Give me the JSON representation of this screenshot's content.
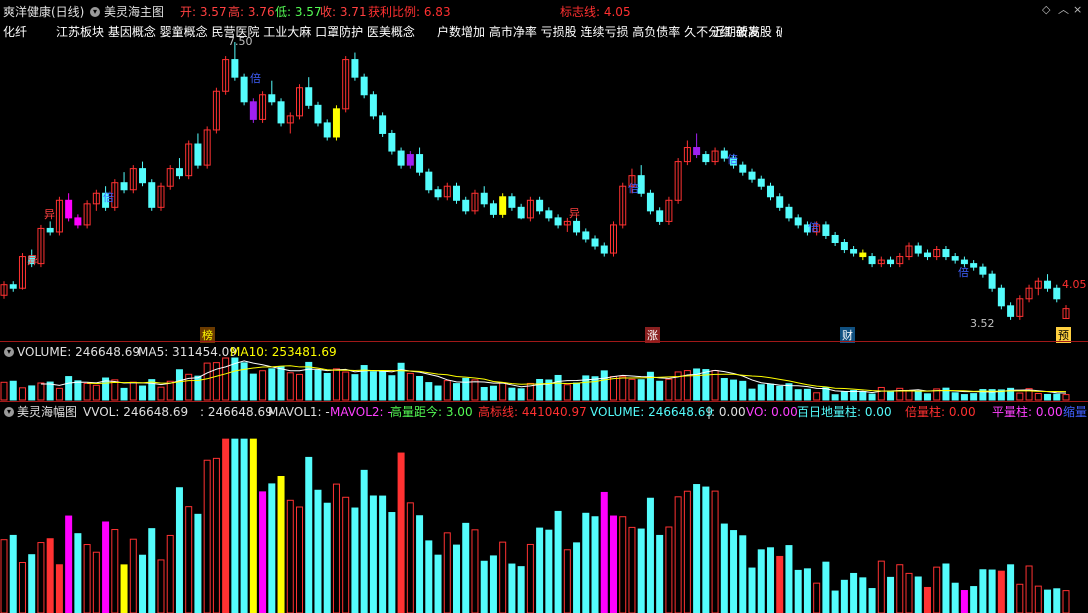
{
  "header": {
    "stock_name": "爽洋健康(日线)",
    "indicator_name": "美灵海主图",
    "open": "开: 3.57",
    "high": "高: 3.76",
    "low": "低: 3.57",
    "close": "收: 3.71",
    "profit_ratio": "获利比例: 6.83",
    "flag_line": "标志线: 4.05"
  },
  "concepts": {
    "left": "化纤",
    "group1": "江苏板块  基因概念 婴童概念 民营医院 工业大麻 口罩防护 医美概念",
    "group2": "户数增加 高市净率 亏损股 连续亏损 高负债率 久不分红 破发股 破净股",
    "overlap_text": "近期新高"
  },
  "price_panel": {
    "high_label": "7.50",
    "low_label": "3.52",
    "flag_price_label": "4.05",
    "tag_bang": "榜",
    "tag_zhang": "涨",
    "tag_cai": "财",
    "tag_yu": "预",
    "char_yi": "异",
    "char_bei": "倍",
    "char_zhu": "主",
    "char_ping": "平",
    "char_di": "地"
  },
  "volume_panel": {
    "volume": "VOLUME: 246648.69",
    "ma5": "MA5: 311454.09",
    "ma10": "MA10: 253481.69"
  },
  "amplitude_panel": {
    "name": "美灵海幅图",
    "vvol": "VVOL: 246648.69",
    "val": ": 246648.69",
    "mavol1": "MAVOL1: -",
    "mavol2": "MAVOL2: -",
    "gaoliang": "高量距今: 3.00",
    "gaobiao": "高标线: 441040.97",
    "volume": "VOLUME: 246648.69",
    "bar": "|: 0.00",
    "vo": "VO: 0.00",
    "bairi": "百日地量柱: 0.00",
    "beiliang": "倍量柱: 0.00",
    "pingliang": "平量柱: 0.00",
    "suoliang": "缩量"
  },
  "colors": {
    "up": "#ff3232",
    "down": "#54fcfc",
    "yellow": "#ffff00",
    "magenta": "#ff00ff",
    "purple": "#a020f0",
    "ma5": "#ffffff",
    "ma10": "#ffff00",
    "separator": "#a01818"
  },
  "chart_data": {
    "type": "candlestick",
    "price_range": [
      3.52,
      7.5
    ],
    "ohlc": [
      [
        3.9,
        4.1,
        3.85,
        4.05
      ],
      [
        4.05,
        4.1,
        3.95,
        4.0
      ],
      [
        4.0,
        4.5,
        3.98,
        4.45
      ],
      [
        4.45,
        4.55,
        4.3,
        4.35
      ],
      [
        4.35,
        4.9,
        4.3,
        4.85
      ],
      [
        4.85,
        4.95,
        4.75,
        4.8
      ],
      [
        4.8,
        5.3,
        4.75,
        5.25
      ],
      [
        5.25,
        5.35,
        4.95,
        5.0
      ],
      [
        5.0,
        5.05,
        4.85,
        4.9
      ],
      [
        4.9,
        5.25,
        4.85,
        5.2
      ],
      [
        5.2,
        5.4,
        5.1,
        5.35
      ],
      [
        5.35,
        5.45,
        5.1,
        5.15
      ],
      [
        5.15,
        5.55,
        5.1,
        5.5
      ],
      [
        5.5,
        5.65,
        5.35,
        5.4
      ],
      [
        5.4,
        5.75,
        5.35,
        5.7
      ],
      [
        5.7,
        5.8,
        5.45,
        5.5
      ],
      [
        5.5,
        5.55,
        5.1,
        5.15
      ],
      [
        5.15,
        5.5,
        5.1,
        5.45
      ],
      [
        5.45,
        5.75,
        5.4,
        5.7
      ],
      [
        5.7,
        5.85,
        5.55,
        5.6
      ],
      [
        5.6,
        6.1,
        5.55,
        6.05
      ],
      [
        6.05,
        6.2,
        5.7,
        5.75
      ],
      [
        5.75,
        6.3,
        5.7,
        6.25
      ],
      [
        6.25,
        6.85,
        6.2,
        6.8
      ],
      [
        6.8,
        7.3,
        6.75,
        7.25
      ],
      [
        7.25,
        7.5,
        6.95,
        7.0
      ],
      [
        7.0,
        7.05,
        6.6,
        6.65
      ],
      [
        6.65,
        6.7,
        6.35,
        6.4
      ],
      [
        6.4,
        6.8,
        6.35,
        6.75
      ],
      [
        6.75,
        6.95,
        6.6,
        6.65
      ],
      [
        6.65,
        6.7,
        6.3,
        6.35
      ],
      [
        6.35,
        6.5,
        6.2,
        6.45
      ],
      [
        6.45,
        6.9,
        6.4,
        6.85
      ],
      [
        6.85,
        7.0,
        6.55,
        6.6
      ],
      [
        6.6,
        6.65,
        6.3,
        6.35
      ],
      [
        6.35,
        6.4,
        6.1,
        6.15
      ],
      [
        6.15,
        6.6,
        6.1,
        6.55
      ],
      [
        6.55,
        7.3,
        6.5,
        7.25
      ],
      [
        7.25,
        7.35,
        6.95,
        7.0
      ],
      [
        7.0,
        7.05,
        6.7,
        6.75
      ],
      [
        6.75,
        6.8,
        6.4,
        6.45
      ],
      [
        6.45,
        6.5,
        6.15,
        6.2
      ],
      [
        6.2,
        6.25,
        5.9,
        5.95
      ],
      [
        5.95,
        6.0,
        5.7,
        5.75
      ],
      [
        5.75,
        5.95,
        5.7,
        5.9
      ],
      [
        5.9,
        6.0,
        5.6,
        5.65
      ],
      [
        5.65,
        5.7,
        5.35,
        5.4
      ],
      [
        5.4,
        5.45,
        5.25,
        5.3
      ],
      [
        5.3,
        5.5,
        5.25,
        5.45
      ],
      [
        5.45,
        5.5,
        5.2,
        5.25
      ],
      [
        5.25,
        5.3,
        5.05,
        5.1
      ],
      [
        5.1,
        5.4,
        5.05,
        5.35
      ],
      [
        5.35,
        5.45,
        5.15,
        5.2
      ],
      [
        5.2,
        5.25,
        5.0,
        5.05
      ],
      [
        5.05,
        5.35,
        5.0,
        5.3
      ],
      [
        5.3,
        5.35,
        5.1,
        5.15
      ],
      [
        5.15,
        5.2,
        4.98,
        5.0
      ],
      [
        5.0,
        5.3,
        4.95,
        5.25
      ],
      [
        5.25,
        5.3,
        5.05,
        5.1
      ],
      [
        5.1,
        5.15,
        4.95,
        5.0
      ],
      [
        5.0,
        5.05,
        4.85,
        4.9
      ],
      [
        4.9,
        5.0,
        4.8,
        4.95
      ],
      [
        4.95,
        5.0,
        4.75,
        4.8
      ],
      [
        4.8,
        4.85,
        4.65,
        4.7
      ],
      [
        4.7,
        4.75,
        4.55,
        4.6
      ],
      [
        4.6,
        4.65,
        4.45,
        4.5
      ],
      [
        4.5,
        4.95,
        4.45,
        4.9
      ],
      [
        4.9,
        5.5,
        4.85,
        5.45
      ],
      [
        5.45,
        5.7,
        5.35,
        5.6
      ],
      [
        5.6,
        5.75,
        5.3,
        5.35
      ],
      [
        5.35,
        5.4,
        5.05,
        5.1
      ],
      [
        5.1,
        5.15,
        4.9,
        4.95
      ],
      [
        4.95,
        5.3,
        4.9,
        5.25
      ],
      [
        5.25,
        5.85,
        5.2,
        5.8
      ],
      [
        5.8,
        6.1,
        5.75,
        6.0
      ],
      [
        6.0,
        6.2,
        5.85,
        5.9
      ],
      [
        5.9,
        5.95,
        5.75,
        5.8
      ],
      [
        5.8,
        6.0,
        5.75,
        5.95
      ],
      [
        5.95,
        6.0,
        5.8,
        5.85
      ],
      [
        5.85,
        5.9,
        5.7,
        5.75
      ],
      [
        5.75,
        5.8,
        5.6,
        5.65
      ],
      [
        5.65,
        5.7,
        5.5,
        5.55
      ],
      [
        5.55,
        5.6,
        5.4,
        5.45
      ],
      [
        5.45,
        5.5,
        5.25,
        5.3
      ],
      [
        5.3,
        5.35,
        5.1,
        5.15
      ],
      [
        5.15,
        5.2,
        4.95,
        5.0
      ],
      [
        5.0,
        5.05,
        4.85,
        4.9
      ],
      [
        4.9,
        4.95,
        4.75,
        4.8
      ],
      [
        4.8,
        4.95,
        4.75,
        4.9
      ],
      [
        4.9,
        4.95,
        4.7,
        4.75
      ],
      [
        4.75,
        4.8,
        4.6,
        4.65
      ],
      [
        4.65,
        4.7,
        4.5,
        4.55
      ],
      [
        4.55,
        4.6,
        4.45,
        4.5
      ],
      [
        4.5,
        4.55,
        4.4,
        4.45
      ],
      [
        4.45,
        4.5,
        4.3,
        4.35
      ],
      [
        4.35,
        4.45,
        4.3,
        4.4
      ],
      [
        4.4,
        4.45,
        4.3,
        4.35
      ],
      [
        4.35,
        4.5,
        4.3,
        4.45
      ],
      [
        4.45,
        4.65,
        4.4,
        4.6
      ],
      [
        4.6,
        4.65,
        4.45,
        4.5
      ],
      [
        4.5,
        4.55,
        4.4,
        4.45
      ],
      [
        4.45,
        4.6,
        4.4,
        4.55
      ],
      [
        4.55,
        4.6,
        4.4,
        4.45
      ],
      [
        4.45,
        4.5,
        4.35,
        4.4
      ],
      [
        4.4,
        4.45,
        4.3,
        4.35
      ],
      [
        4.35,
        4.4,
        4.25,
        4.3
      ],
      [
        4.3,
        4.35,
        4.15,
        4.2
      ],
      [
        4.2,
        4.25,
        3.95,
        4.0
      ],
      [
        4.0,
        4.05,
        3.7,
        3.75
      ],
      [
        3.75,
        3.8,
        3.55,
        3.6
      ],
      [
        3.6,
        3.9,
        3.55,
        3.85
      ],
      [
        3.85,
        4.05,
        3.8,
        4.0
      ],
      [
        4.0,
        4.15,
        3.9,
        4.1
      ],
      [
        4.1,
        4.2,
        3.95,
        4.0
      ],
      [
        4.0,
        4.05,
        3.8,
        3.85
      ],
      [
        3.57,
        3.76,
        3.57,
        3.71
      ]
    ]
  }
}
